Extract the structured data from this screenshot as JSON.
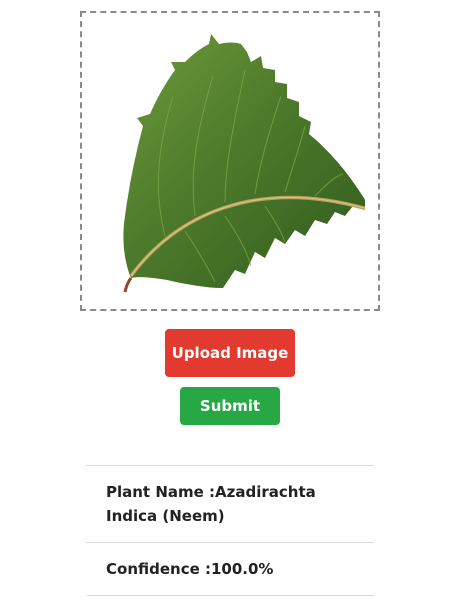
{
  "upload": {
    "button_label": "Upload Image",
    "button_color": "#e23a2e",
    "preview_icon": "neem-leaf-image"
  },
  "submit": {
    "button_label": "Submit",
    "button_color": "#28a745"
  },
  "result": {
    "plant_name_line": "Plant Name :Azadirachta Indica (Neem)",
    "confidence_line": "Confidence :100.0%"
  }
}
